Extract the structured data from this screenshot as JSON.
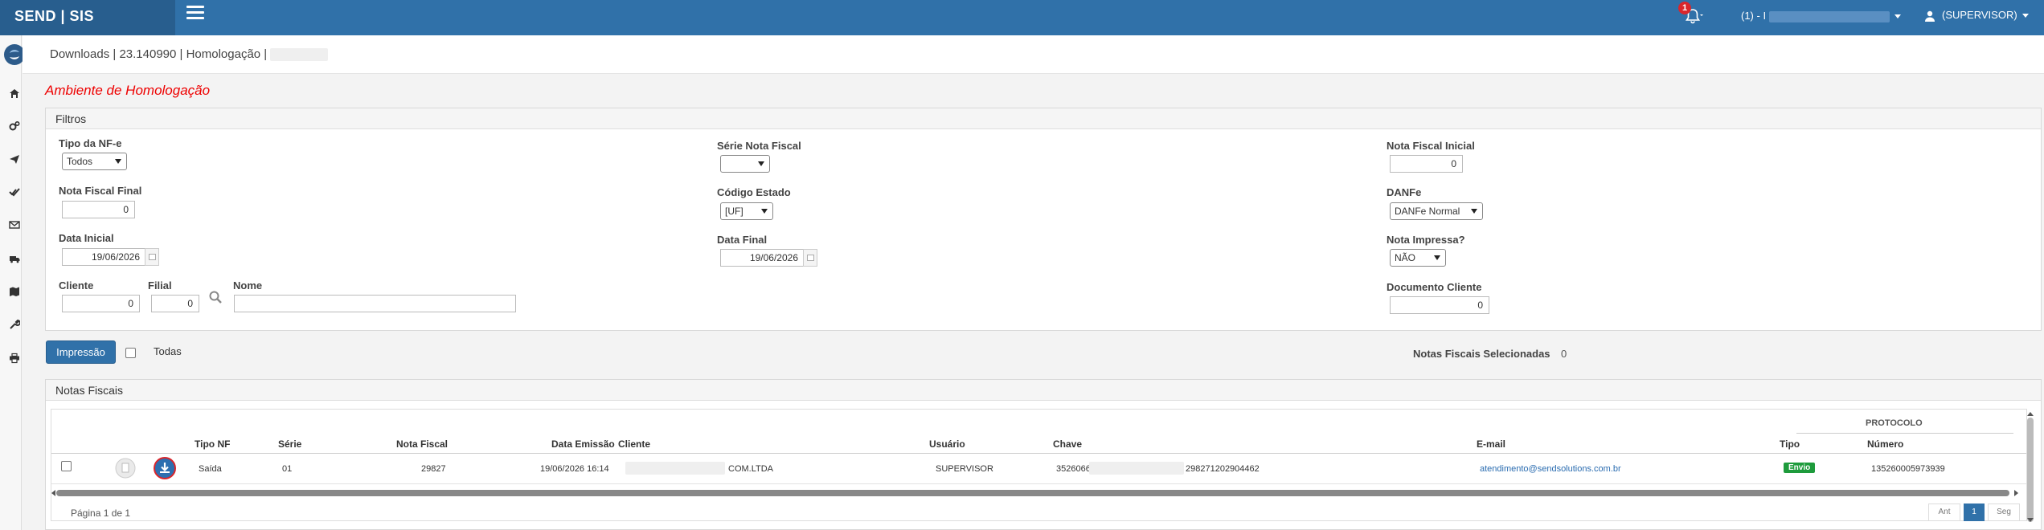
{
  "app": {
    "brand": "SEND | SIS"
  },
  "topbar": {
    "notification_count": "1",
    "company_label": "(1) - I",
    "user_label": "(SUPERVISOR)"
  },
  "breadcrumb": {
    "text": "Downloads | 23.140990 | Homologação |"
  },
  "environment_title": "Ambiente de Homologação",
  "filters": {
    "title": "Filtros",
    "tipo_nfe": {
      "label": "Tipo da NF-e",
      "value": "Todos"
    },
    "serie_nota": {
      "label": "Série Nota Fiscal",
      "value": ""
    },
    "nota_inicial": {
      "label": "Nota Fiscal Inicial",
      "value": "0"
    },
    "nota_final": {
      "label": "Nota Fiscal Final",
      "value": "0"
    },
    "codigo_estado": {
      "label": "Código Estado",
      "value": "[UF]"
    },
    "danfe": {
      "label": "DANFe",
      "value": "DANFe Normal"
    },
    "data_inicial": {
      "label": "Data Inicial",
      "value": "19/06/2026"
    },
    "data_final": {
      "label": "Data Final",
      "value": "19/06/2026"
    },
    "nota_impressa": {
      "label": "Nota Impressa?",
      "value": "NÃO"
    },
    "cliente": {
      "label": "Cliente",
      "value": "0"
    },
    "filial": {
      "label": "Filial",
      "value": "0"
    },
    "nome": {
      "label": "Nome",
      "value": ""
    },
    "documento_cliente": {
      "label": "Documento Cliente",
      "value": "0"
    }
  },
  "actions": {
    "print_label": "Impressão",
    "todas_label": "Todas",
    "selected_label": "Notas Fiscais Selecionadas",
    "selected_count": "0"
  },
  "notas": {
    "title": "Notas Fiscais",
    "protocolo_group": "PROTOCOLO",
    "columns": {
      "tipo_nf": "Tipo NF",
      "serie": "Série",
      "nota_fiscal": "Nota Fiscal",
      "data_emissao": "Data Emissão",
      "cliente": "Cliente",
      "usuario": "Usuário",
      "chave": "Chave",
      "email": "E-mail",
      "tipo": "Tipo",
      "numero": "Número"
    },
    "rows": [
      {
        "tipo_nf": "Saída",
        "serie": "01",
        "nota_fiscal": "29827",
        "data_emissao": "19/06/2026 16:14",
        "cliente": "COM.LTDA",
        "usuario": "SUPERVISOR",
        "chave_prefix": "3526066",
        "chave_suffix": "298271202904462",
        "email": "atendimento@sendsolutions.com.br",
        "tipo": "Envio",
        "numero": "135260005973939"
      }
    ]
  },
  "pagination": {
    "info": "Página 1 de 1",
    "prev": "Ant",
    "current": "1",
    "next": "Seg"
  },
  "colors": {
    "navbar": "#3071a9",
    "brand_bg": "#285e8e",
    "env_title": "#ee0000",
    "badge": "#d9262c",
    "tag_envio": "#1e9b3c",
    "link": "#2a6cb0"
  }
}
